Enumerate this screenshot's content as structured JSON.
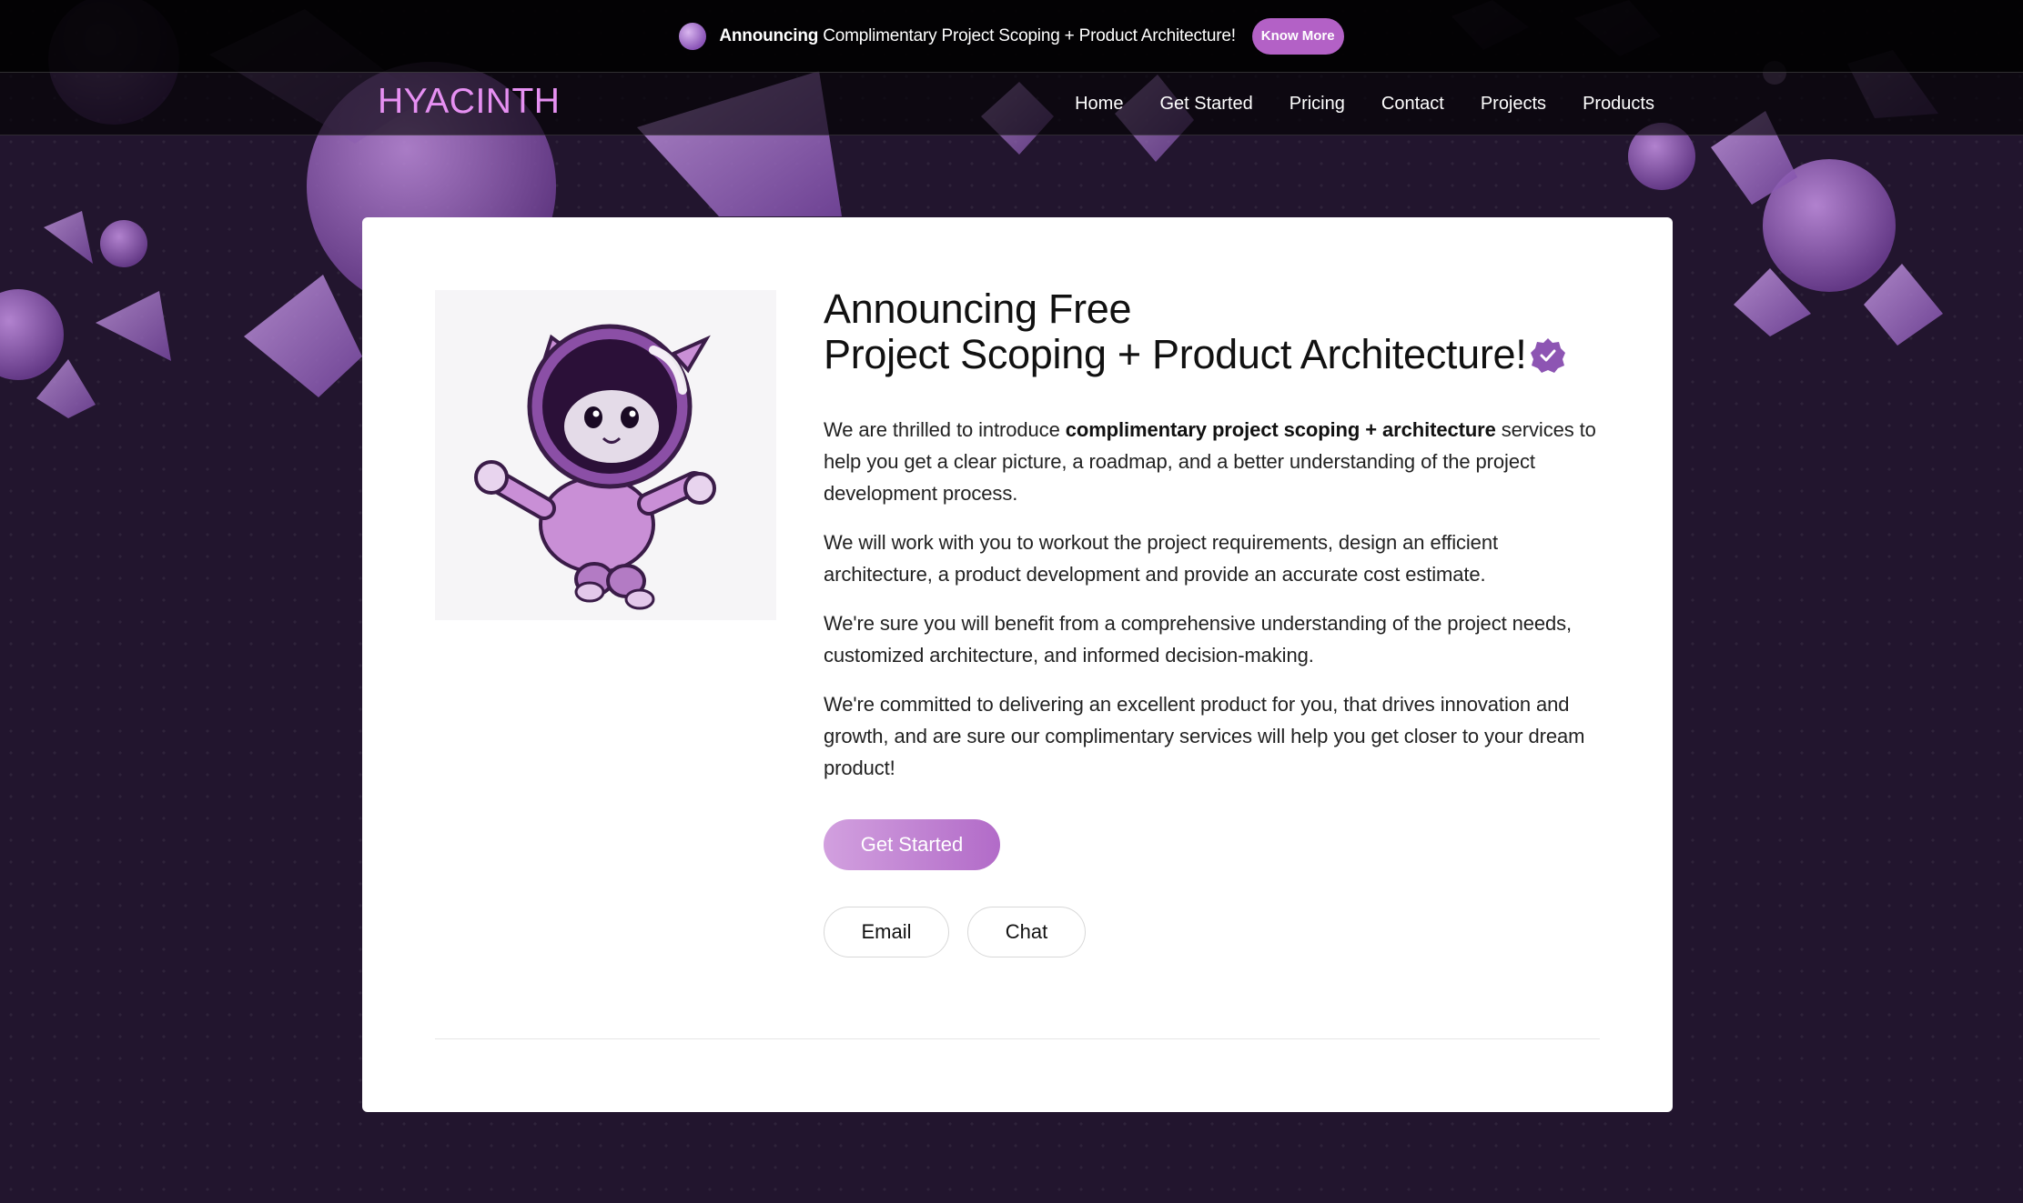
{
  "announcement": {
    "bold": "Announcing",
    "text": " Complimentary Project Scoping + Product Architecture!",
    "button": "Know More"
  },
  "brand": "HYACINTH",
  "nav": [
    "Home",
    "Get Started",
    "Pricing",
    "Contact",
    "Projects",
    "Products"
  ],
  "hero": {
    "title_line1": "Announcing Free",
    "title_line2": "Project Scoping + Product Architecture!",
    "p1_pre": "We are thrilled to introduce ",
    "p1_bold": "complimentary project scoping + architecture",
    "p1_post": " services to help you get a clear picture, a roadmap, and a better understanding of the project development process.",
    "p2": "We will work with you to workout the project requirements, design an efficient architecture, a product development and provide an accurate cost estimate.",
    "p3": "We're sure you will benefit from a comprehensive understanding of the project needs, customized architecture, and informed decision-making.",
    "p4": "We're committed to delivering an excellent product for you, that drives innovation and growth, and are sure our complimentary services will help you get closer to your dream product!",
    "cta": "Get Started",
    "email": "Email",
    "chat": "Chat"
  },
  "colors": {
    "background": "#22152e",
    "brand": "#e690f2",
    "accent": "#b361c6",
    "cta_gradient_start": "#d2a0df",
    "cta_gradient_end": "#b26bc8"
  },
  "icons": {
    "announcement": "purple-orb-icon",
    "verified": "verified-badge-icon",
    "illustration": "astronaut-cat-illustration"
  }
}
